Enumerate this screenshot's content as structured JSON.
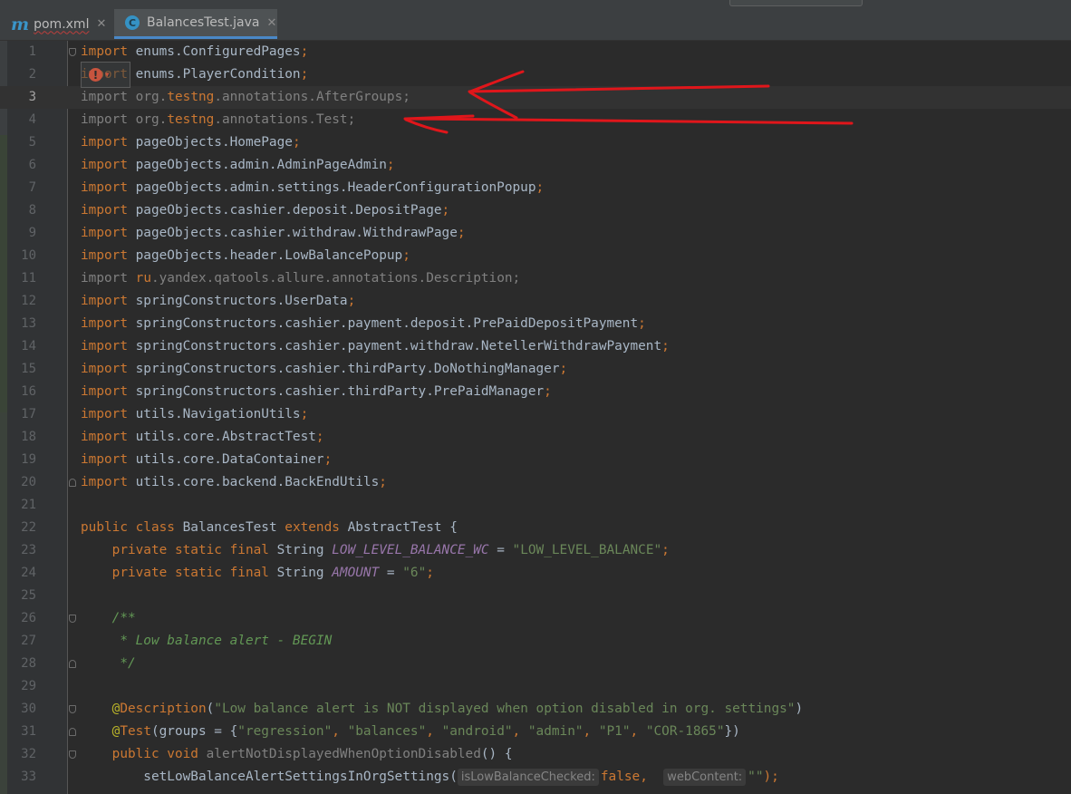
{
  "tabs": [
    {
      "label": "pom.xml",
      "icon": "maven-m-icon",
      "active": false,
      "has_error": true
    },
    {
      "label": "BalancesTest.java",
      "icon": "java-class-icon",
      "active": true
    }
  ],
  "editor": {
    "current_line": 3,
    "lines": [
      {
        "num": "1",
        "tokens": [
          {
            "t": "import",
            "c": "kw"
          },
          {
            "t": " enums.ConfiguredPages",
            "c": "id"
          },
          {
            "t": ";",
            "c": "kw"
          }
        ]
      },
      {
        "num": "2",
        "tokens": [
          {
            "t": "import",
            "c": "kw"
          },
          {
            "t": " enums.PlayerCondition",
            "c": "id"
          },
          {
            "t": ";",
            "c": "kw"
          }
        ]
      },
      {
        "num": "3",
        "tokens": [
          {
            "t": "import ",
            "c": "unused"
          },
          {
            "t": "org",
            "c": "unused"
          },
          {
            "t": ".",
            "c": "unused"
          },
          {
            "t": "testng",
            "c": "kw"
          },
          {
            "t": ".annotations.AfterGroups;",
            "c": "unused"
          }
        ]
      },
      {
        "num": "4",
        "tokens": [
          {
            "t": "import ",
            "c": "unused"
          },
          {
            "t": "org",
            "c": "unused"
          },
          {
            "t": ".",
            "c": "unused"
          },
          {
            "t": "testng",
            "c": "kw"
          },
          {
            "t": ".annotations.Test;",
            "c": "unused"
          }
        ]
      },
      {
        "num": "5",
        "tokens": [
          {
            "t": "import",
            "c": "kw"
          },
          {
            "t": " pageObjects.HomePage",
            "c": "id"
          },
          {
            "t": ";",
            "c": "kw"
          }
        ]
      },
      {
        "num": "6",
        "tokens": [
          {
            "t": "import",
            "c": "kw"
          },
          {
            "t": " pageObjects.admin.AdminPageAdmin",
            "c": "id"
          },
          {
            "t": ";",
            "c": "kw"
          }
        ]
      },
      {
        "num": "7",
        "tokens": [
          {
            "t": "import",
            "c": "kw"
          },
          {
            "t": " pageObjects.admin.settings.HeaderConfigurationPopup",
            "c": "id"
          },
          {
            "t": ";",
            "c": "kw"
          }
        ]
      },
      {
        "num": "8",
        "tokens": [
          {
            "t": "import",
            "c": "kw"
          },
          {
            "t": " pageObjects.cashier.deposit.DepositPage",
            "c": "id"
          },
          {
            "t": ";",
            "c": "kw"
          }
        ]
      },
      {
        "num": "9",
        "tokens": [
          {
            "t": "import",
            "c": "kw"
          },
          {
            "t": " pageObjects.cashier.withdraw.WithdrawPage",
            "c": "id"
          },
          {
            "t": ";",
            "c": "kw"
          }
        ]
      },
      {
        "num": "10",
        "tokens": [
          {
            "t": "import",
            "c": "kw"
          },
          {
            "t": " pageObjects.header.LowBalancePopup",
            "c": "id"
          },
          {
            "t": ";",
            "c": "kw"
          }
        ]
      },
      {
        "num": "11",
        "tokens": [
          {
            "t": "import ",
            "c": "unused"
          },
          {
            "t": "ru",
            "c": "kw"
          },
          {
            "t": ".yandex.qatools.allure.annotations.Description;",
            "c": "unused"
          }
        ]
      },
      {
        "num": "12",
        "tokens": [
          {
            "t": "import",
            "c": "kw"
          },
          {
            "t": " springConstructors.UserData",
            "c": "id"
          },
          {
            "t": ";",
            "c": "kw"
          }
        ]
      },
      {
        "num": "13",
        "tokens": [
          {
            "t": "import",
            "c": "kw"
          },
          {
            "t": " springConstructors.cashier.payment.deposit.PrePaidDepositPayment",
            "c": "id"
          },
          {
            "t": ";",
            "c": "kw"
          }
        ]
      },
      {
        "num": "14",
        "tokens": [
          {
            "t": "import",
            "c": "kw"
          },
          {
            "t": " springConstructors.cashier.payment.withdraw.NetellerWithdrawPayment",
            "c": "id"
          },
          {
            "t": ";",
            "c": "kw"
          }
        ]
      },
      {
        "num": "15",
        "tokens": [
          {
            "t": "import",
            "c": "kw"
          },
          {
            "t": " springConstructors.cashier.thirdParty.DoNothingManager",
            "c": "id"
          },
          {
            "t": ";",
            "c": "kw"
          }
        ]
      },
      {
        "num": "16",
        "tokens": [
          {
            "t": "import",
            "c": "kw"
          },
          {
            "t": " springConstructors.cashier.thirdParty.PrePaidManager",
            "c": "id"
          },
          {
            "t": ";",
            "c": "kw"
          }
        ]
      },
      {
        "num": "17",
        "tokens": [
          {
            "t": "import",
            "c": "kw"
          },
          {
            "t": " utils.NavigationUtils",
            "c": "id"
          },
          {
            "t": ";",
            "c": "kw"
          }
        ]
      },
      {
        "num": "18",
        "tokens": [
          {
            "t": "import",
            "c": "kw"
          },
          {
            "t": " utils.core.AbstractTest",
            "c": "id"
          },
          {
            "t": ";",
            "c": "kw"
          }
        ]
      },
      {
        "num": "19",
        "tokens": [
          {
            "t": "import",
            "c": "kw"
          },
          {
            "t": " utils.core.DataContainer",
            "c": "id"
          },
          {
            "t": ";",
            "c": "kw"
          }
        ]
      },
      {
        "num": "20",
        "tokens": [
          {
            "t": "import",
            "c": "kw"
          },
          {
            "t": " utils.core.backend.BackEndUtils",
            "c": "id"
          },
          {
            "t": ";",
            "c": "kw"
          }
        ]
      },
      {
        "num": "21",
        "tokens": []
      },
      {
        "num": "22",
        "tokens": [
          {
            "t": "public class ",
            "c": "kw"
          },
          {
            "t": "BalancesTest ",
            "c": "id"
          },
          {
            "t": "extends ",
            "c": "kw"
          },
          {
            "t": "AbstractTest {",
            "c": "id"
          }
        ]
      },
      {
        "num": "23",
        "tokens": [
          {
            "t": "    private static final ",
            "c": "kw"
          },
          {
            "t": "String ",
            "c": "id"
          },
          {
            "t": "LOW_LEVEL_BALANCE_WC",
            "c": "const"
          },
          {
            "t": " = ",
            "c": "id"
          },
          {
            "t": "\"LOW_LEVEL_BALANCE\"",
            "c": "str"
          },
          {
            "t": ";",
            "c": "kw"
          }
        ]
      },
      {
        "num": "24",
        "tokens": [
          {
            "t": "    private static final ",
            "c": "kw"
          },
          {
            "t": "String ",
            "c": "id"
          },
          {
            "t": "AMOUNT",
            "c": "const"
          },
          {
            "t": " = ",
            "c": "id"
          },
          {
            "t": "\"6\"",
            "c": "str"
          },
          {
            "t": ";",
            "c": "kw"
          }
        ]
      },
      {
        "num": "25",
        "tokens": []
      },
      {
        "num": "26",
        "tokens": [
          {
            "t": "    /**",
            "c": "cmt"
          }
        ]
      },
      {
        "num": "27",
        "tokens": [
          {
            "t": "     * Low balance alert - BEGIN",
            "c": "cmt"
          }
        ]
      },
      {
        "num": "28",
        "tokens": [
          {
            "t": "     */",
            "c": "cmt"
          }
        ]
      },
      {
        "num": "29",
        "tokens": []
      },
      {
        "num": "30",
        "tokens": [
          {
            "t": "    @",
            "c": "ann"
          },
          {
            "t": "Description",
            "c": "kw"
          },
          {
            "t": "(",
            "c": "id"
          },
          {
            "t": "\"Low balance alert is NOT displayed when option disabled in org. settings\"",
            "c": "str"
          },
          {
            "t": ")",
            "c": "id"
          }
        ]
      },
      {
        "num": "31",
        "tokens": [
          {
            "t": "    @",
            "c": "ann"
          },
          {
            "t": "Test",
            "c": "kw"
          },
          {
            "t": "(groups = {",
            "c": "id"
          },
          {
            "t": "\"regression\"",
            "c": "str"
          },
          {
            "t": ", ",
            "c": "kw"
          },
          {
            "t": "\"balances\"",
            "c": "str"
          },
          {
            "t": ", ",
            "c": "kw"
          },
          {
            "t": "\"android\"",
            "c": "str"
          },
          {
            "t": ", ",
            "c": "kw"
          },
          {
            "t": "\"admin\"",
            "c": "str"
          },
          {
            "t": ", ",
            "c": "kw"
          },
          {
            "t": "\"P1\"",
            "c": "str"
          },
          {
            "t": ", ",
            "c": "kw"
          },
          {
            "t": "\"COR-1865\"",
            "c": "str"
          },
          {
            "t": "})",
            "c": "id"
          }
        ]
      },
      {
        "num": "32",
        "tokens": [
          {
            "t": "    public void ",
            "c": "kw"
          },
          {
            "t": "alertNotDisplayedWhenOptionDisabled",
            "c": "unused"
          },
          {
            "t": "() {",
            "c": "id"
          }
        ]
      },
      {
        "num": "33",
        "tokens": [
          {
            "t": "        setLowBalanceAlertSettingsInOrgSettings(",
            "c": "id"
          },
          {
            "t": "isLowBalanceChecked:",
            "c": "hint"
          },
          {
            "t": "false",
            "c": "kw"
          },
          {
            "t": ",  ",
            "c": "kw"
          },
          {
            "t": "webContent:",
            "c": "hint"
          },
          {
            "t": "\"\"",
            "c": "str"
          },
          {
            "t": ");",
            "c": "kw"
          }
        ]
      }
    ]
  },
  "annotations": {
    "color": "#e0161b",
    "note": "two hand-drawn red arrows pointing left at lines 3 and 4"
  },
  "error_marker": {
    "glyph": "!",
    "caret": "▾"
  }
}
